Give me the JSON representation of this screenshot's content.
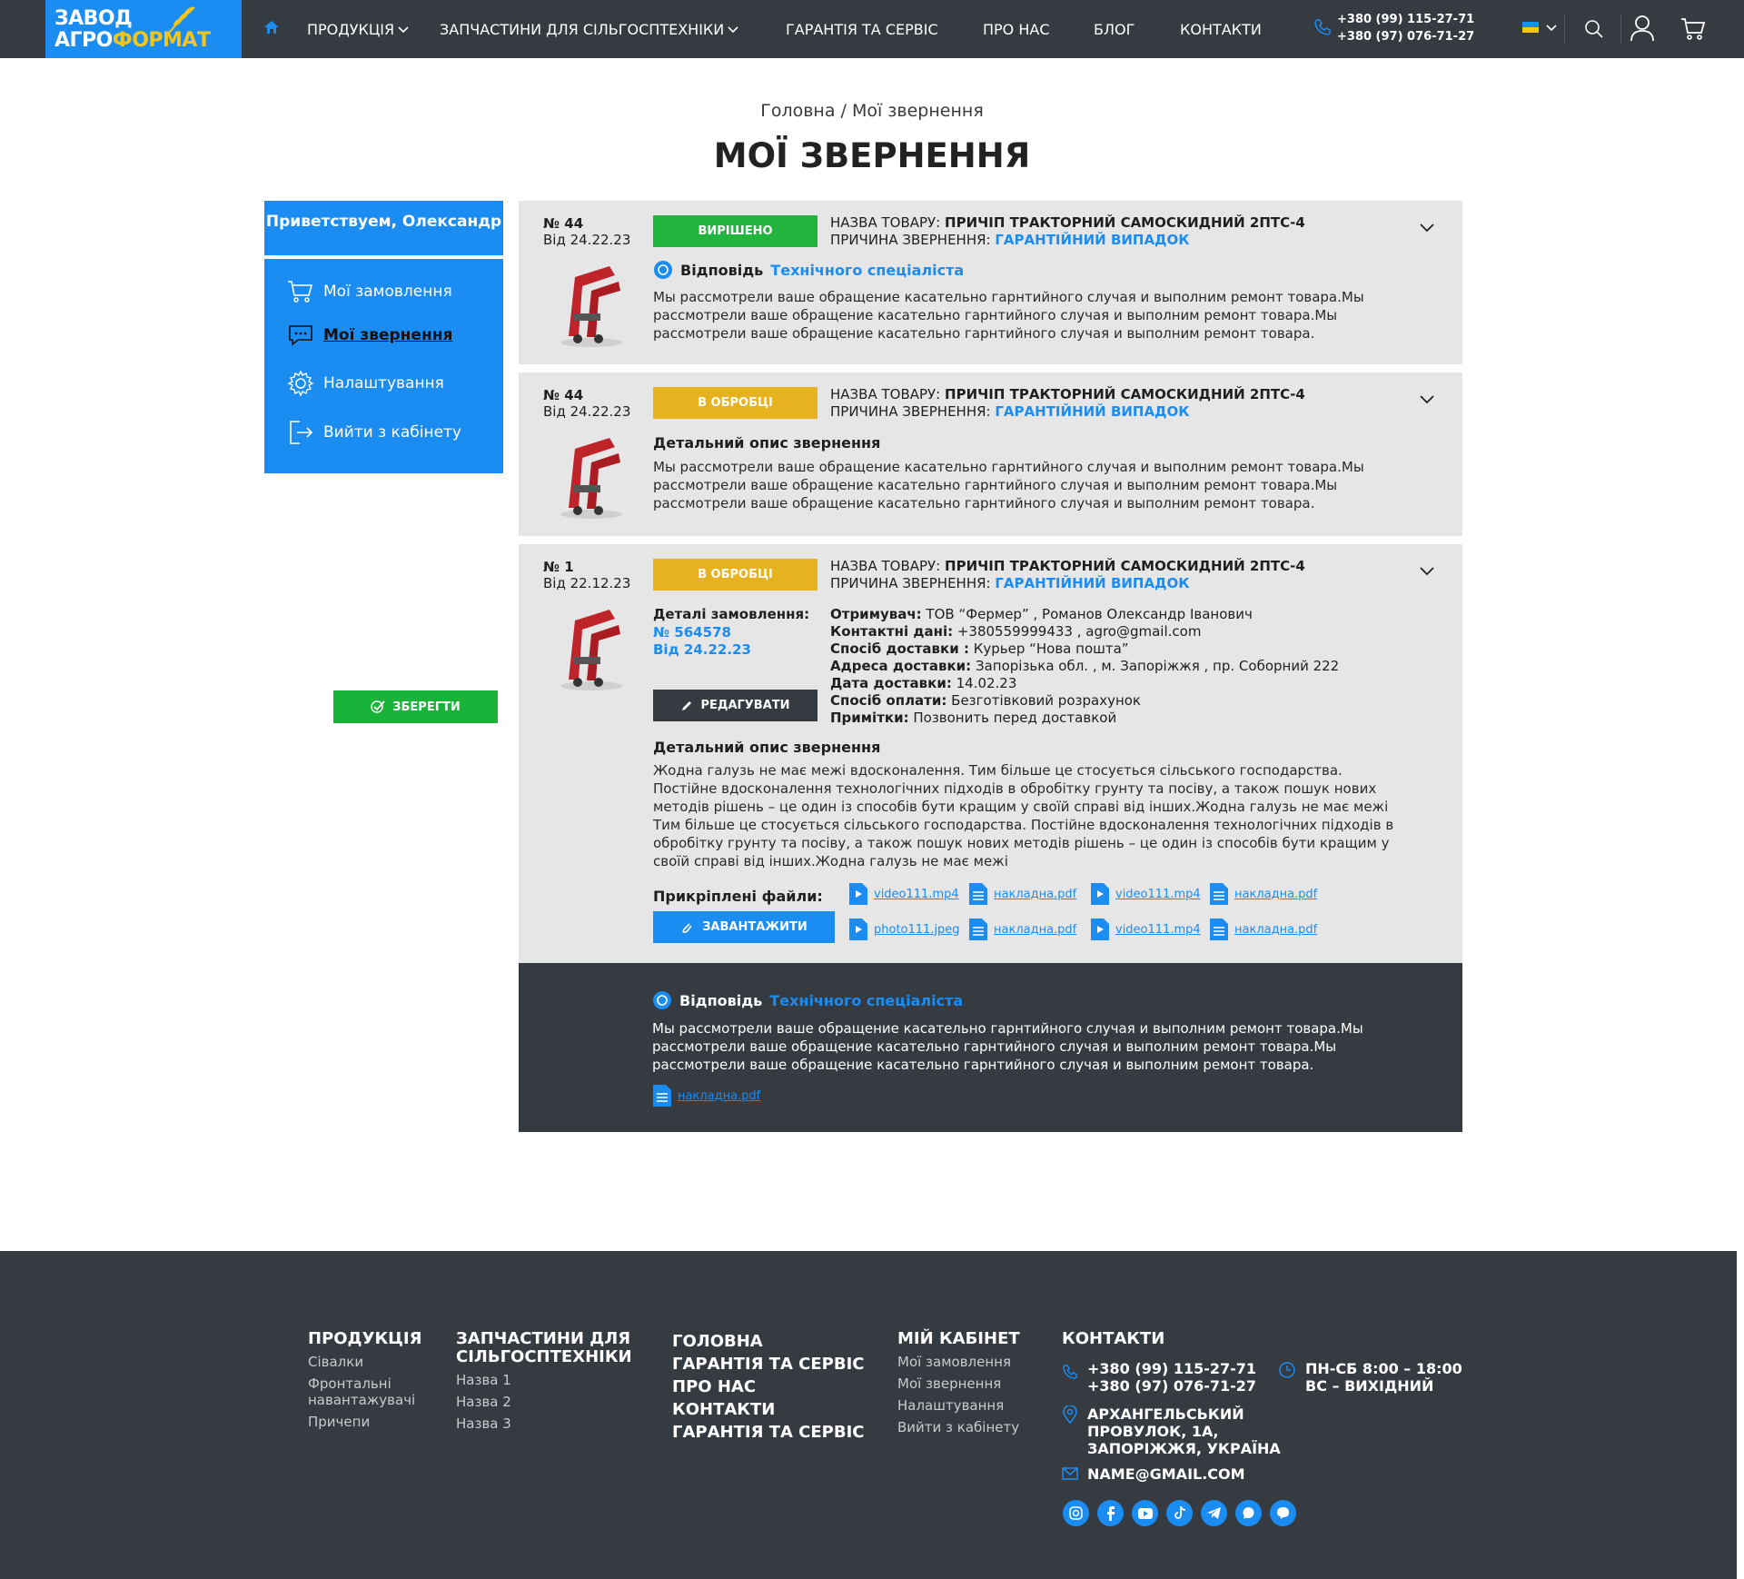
{
  "header": {
    "logo_line1": "ЗАВОД",
    "logo_line2a": "АГРО",
    "logo_line2b": "ФОРМАТ",
    "nav": [
      "ПРОДУКЦІЯ",
      "ЗАПЧАСТИНИ ДЛЯ СІЛЬГОСПТЕХНІКИ",
      "ГАРАНТІЯ ТА СЕРВІС",
      "ПРО НАС",
      "БЛОГ",
      "КОНТАКТИ"
    ],
    "phone1": "+380 (99) 115-27-71",
    "phone2": "+380 (97) 076-71-27",
    "lang": "UA"
  },
  "page": {
    "breadcrumb": "Головна / Мої звернення",
    "title": "МОЇ ЗВЕРНЕННЯ"
  },
  "sidebar": {
    "greeting": "Приветствуем, Олександр",
    "items": [
      "Мої замовлення",
      "Мої звернення",
      "Налаштування",
      "Вийти з кабінету"
    ],
    "save_label": "ЗБЕРЕГТИ"
  },
  "appeals": [
    {
      "no": "№ 44",
      "date": "Від 24.22.23",
      "status": "ВИРІШЕНО",
      "prod_lbl": "НАЗВА ТОВАРУ:",
      "product": "ПРИЧІП ТРАКТОРНИЙ САМОСКИДНИЙ 2ПТС-4",
      "reason_lbl": "ПРИЧИНА ЗВЕРНЕННЯ:",
      "reason": "ГАРАНТІЙНИЙ ВИПАДОК",
      "resp_lbl": "Відповідь",
      "resp_who": "Технічного спеціаліста",
      "text": "Мы рассмотрели ваше обращение касательно гарнтийного случая и выполним ремонт  товара.Мы рассмотрели ваше обращение касательно гарнтийного случая и выполним ремонт  товара.Мы рассмотрели ваше обращение касательно гарнтийного случая и выполним ремонт  товара."
    },
    {
      "no": "№ 44",
      "date": "Від 24.22.23",
      "status": "В ОБРОБЦІ",
      "prod_lbl": "НАЗВА ТОВАРУ:",
      "product": "ПРИЧІП ТРАКТОРНИЙ САМОСКИДНИЙ 2ПТС-4",
      "reason_lbl": "ПРИЧИНА ЗВЕРНЕННЯ:",
      "reason": "ГАРАНТІЙНИЙ ВИПАДОК",
      "desc_lbl": "Детальний опис звернення",
      "text": "Мы рассмотрели ваше обращение касательно гарнтийного случая и выполним ремонт  товара.Мы рассмотрели ваше обращение касательно гарнтийного случая и выполним ремонт  товара.Мы рассмотрели ваше обращение касательно гарнтийного случая и выполним ремонт  товара."
    },
    {
      "no": "№ 1",
      "date": "Від 22.12.23",
      "status": "В ОБРОБЦІ",
      "prod_lbl": "НАЗВА ТОВАРУ:",
      "product": "ПРИЧІП ТРАКТОРНИЙ САМОСКИДНИЙ 2ПТС-4",
      "reason_lbl": "ПРИЧИНА ЗВЕРНЕННЯ:",
      "reason": "ГАРАНТІЙНИЙ ВИПАДОК",
      "order_lbl": "Деталі замовлення:",
      "order_no": "№ 564578",
      "order_date": "Від 24.22.23",
      "edit_label": "РЕДАГУВАТИ",
      "details": [
        {
          "k": "Отримувач:",
          "v": " ТОВ “Фермер” , Романов Олександр Іванович"
        },
        {
          "k": "Контактні дані:",
          "v": "  +380559999433 , agro@gmail.com"
        },
        {
          "k": "Спосіб доставки :",
          "v": " Курьер “Нова пошта”"
        },
        {
          "k": "Адреса доставки:",
          "v": " Запорізька обл. , м. Запоріжжя , пр. Соборний 222"
        },
        {
          "k": "Дата доставки:",
          "v": "   14.02.23"
        },
        {
          "k": "Спосіб оплати:",
          "v": " Безготівковий розрахунок"
        },
        {
          "k": "Примітки:",
          "v": " Позвонить перед доставкой"
        }
      ],
      "desc_lbl": "Детальний опис звернення",
      "text": "Жодна галузь не має межі вдосконалення. Тим більше це стосується сільського господарства. Постійне вдосконалення технологічних підходів в обробітку грунту та посіву, а також пошук нових методів рішень – це один із способів бути кращим у своїй справі від інших.Жодна галузь не має межі Тим більше це стосується сільського господарства. Постійне вдосконалення технологічних підходів в обробітку грунту та посіву, а також пошук нових методів рішень – це один із способів бути кращим у своїй справі від інших.Жодна галузь не має межі",
      "att_lbl": "Прикріплені файли:",
      "upload_label": "ЗАВАНТАЖИТИ",
      "files": [
        [
          "video111.mp4",
          "накладна.pdf",
          "video111.mp4",
          "накладна.pdf"
        ],
        [
          "photo111.jpeg",
          "накладна.pdf",
          "video111.mp4",
          "накладна.pdf"
        ]
      ],
      "reply": {
        "resp_lbl": "Відповідь",
        "resp_who": "Технічного спеціаліста",
        "text": "Мы рассмотрели ваше обращение касательно гарнтийного случая и выполним ремонт  товара.Мы рассмотрели ваше обращение касательно гарнтийного случая и выполним ремонт  товара.Мы рассмотрели ваше обращение касательно гарнтийного случая и выполним ремонт  товара.",
        "file": "накладна.pdf"
      }
    }
  ],
  "footer": {
    "products": {
      "title": "ПРОДУКЦІЯ",
      "items": [
        "Сівалки",
        "Фронтальні навантажувачі",
        "Причепи"
      ]
    },
    "parts": {
      "title": "ЗАПЧАСТИНИ ДЛЯ СІЛЬГОСПТЕХНІКИ",
      "items": [
        "Назва 1",
        "Назва 2",
        "Назва 3"
      ]
    },
    "main_links": [
      "ГОЛОВНА",
      "ГАРАНТІЯ ТА СЕРВІС",
      "ПРО НАС",
      "КОНТАКТИ",
      "ГАРАНТІЯ ТА СЕРВІС"
    ],
    "cabinet": {
      "title": "МІЙ КАБІНЕТ",
      "items": [
        "Мої замовлення",
        "Мої звернення",
        "Налаштування",
        "Вийти з кабінету"
      ]
    },
    "contacts": {
      "title": "КОНТАКТИ",
      "phone1": "+380 (99) 115-27-71",
      "phone2": "+380 (97) 076-71-27",
      "addr1": "АРХАНГЕЛЬСЬКИЙ",
      "addr2": "ПРОВУЛОК, 1А,",
      "addr3": "ЗАПОРІЖЖЯ, УКРАЇНА",
      "email": "NAME@GMAIL.COM"
    },
    "hours": {
      "line1": "ПН-СБ  8:00 – 18:00",
      "line2": "ВС – ВИХІДНИЙ"
    },
    "socials": [
      "instagram-icon",
      "facebook-icon",
      "youtube-icon",
      "tiktok-icon",
      "telegram-icon",
      "whatsapp-icon",
      "viber-icon"
    ]
  },
  "colors": {
    "accent": "#1a8cf2",
    "dark": "#353b40",
    "ok": "#21b53e",
    "processing": "#e6b220",
    "yellow": "#f5c518"
  }
}
